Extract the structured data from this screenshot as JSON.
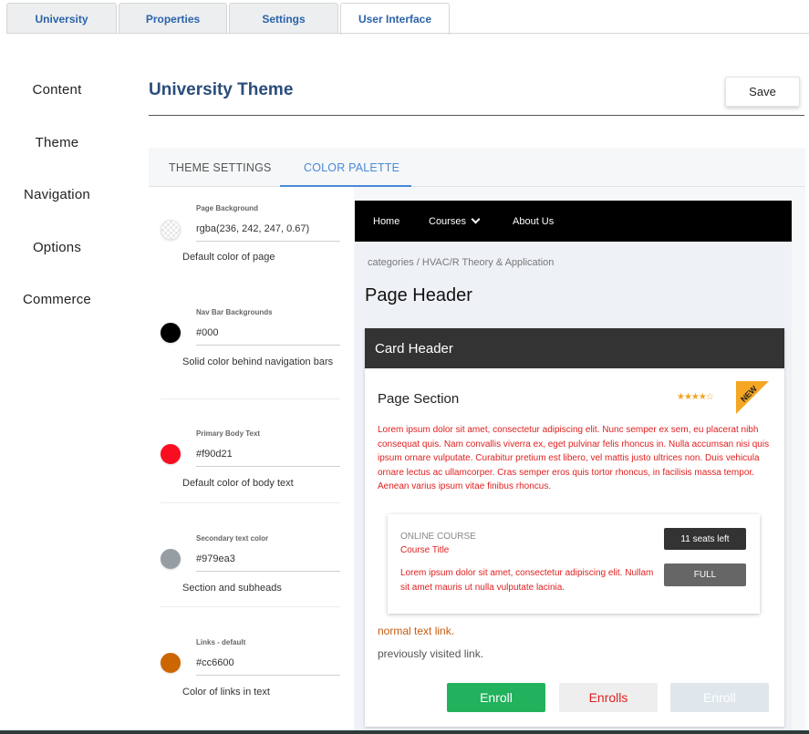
{
  "top_tabs": [
    {
      "label": "University",
      "active": false
    },
    {
      "label": "Properties",
      "active": false
    },
    {
      "label": "Settings",
      "active": false
    },
    {
      "label": "User Interface",
      "active": true
    }
  ],
  "side_nav": [
    {
      "label": "Content"
    },
    {
      "label": "Theme"
    },
    {
      "label": "Navigation"
    },
    {
      "label": "Options"
    },
    {
      "label": "Commerce"
    }
  ],
  "header": {
    "title": "University Theme",
    "save_label": "Save"
  },
  "sub_tabs": [
    {
      "label": "THEME SETTINGS",
      "active": false
    },
    {
      "label": "COLOR PALETTE",
      "active": true
    }
  ],
  "settings": [
    {
      "label": "Page Background",
      "value": "rgba(236, 242, 247, 0.67)",
      "description": "Default color of page",
      "color": "rgba(236, 242, 247, 0.67)"
    },
    {
      "label": "Nav Bar Backgrounds",
      "value": "#000",
      "description": "Solid color behind navigation bars",
      "color": "#000000"
    },
    {
      "label": "Primary Body Text",
      "value": "#f90d21",
      "description": "Default color of body text",
      "color": "#f90d21"
    },
    {
      "label": "Secondary text color",
      "value": "#979ea3",
      "description": "Section and subheads",
      "color": "#979ea3"
    },
    {
      "label": "Links - default",
      "value": "#cc6600",
      "description": "Color of links in text",
      "color": "#cc6600"
    }
  ],
  "preview": {
    "nav": {
      "home": "Home",
      "courses": "Courses",
      "about": "About Us"
    },
    "breadcrumb": "categories / HVAC/R Theory & Application",
    "page_header": "Page Header",
    "card_header": "Card Header",
    "section_title": "Page Section",
    "rating_stars": "★★★★☆",
    "new_badge": "NEW",
    "lorem": "Lorem ipsum dolor sit amet, consectetur adipiscing elit. Nunc semper ex sem, eu placerat nibh consequat quis. Nam convallis viverra ex, eget pulvinar felis rhoncus in. Nulla accumsan nisi quis ipsum ornare vulputate. Curabitur pretium est libero, vel mattis justo ultrices non. Duis vehicula ornare lectus ac ullamcorper. Cras semper eros quis tortor rhoncus, in facilisis massa tempor. Aenean varius ipsum vitae finibus rhoncus.",
    "course": {
      "type": "ONLINE COURSE",
      "title": "Course Title",
      "text": "Lorem ipsum dolor sit amet, consectetur adipiscing elit. Nullam sit amet mauris ut nulla vulputate lacinia.",
      "seats": "11 seats left",
      "full": "FULL"
    },
    "link_normal": "normal text link.",
    "link_visited": "previously visited link.",
    "buttons": {
      "primary": "Enroll",
      "secondary": "Enrolls",
      "disabled": "Enroll"
    }
  }
}
